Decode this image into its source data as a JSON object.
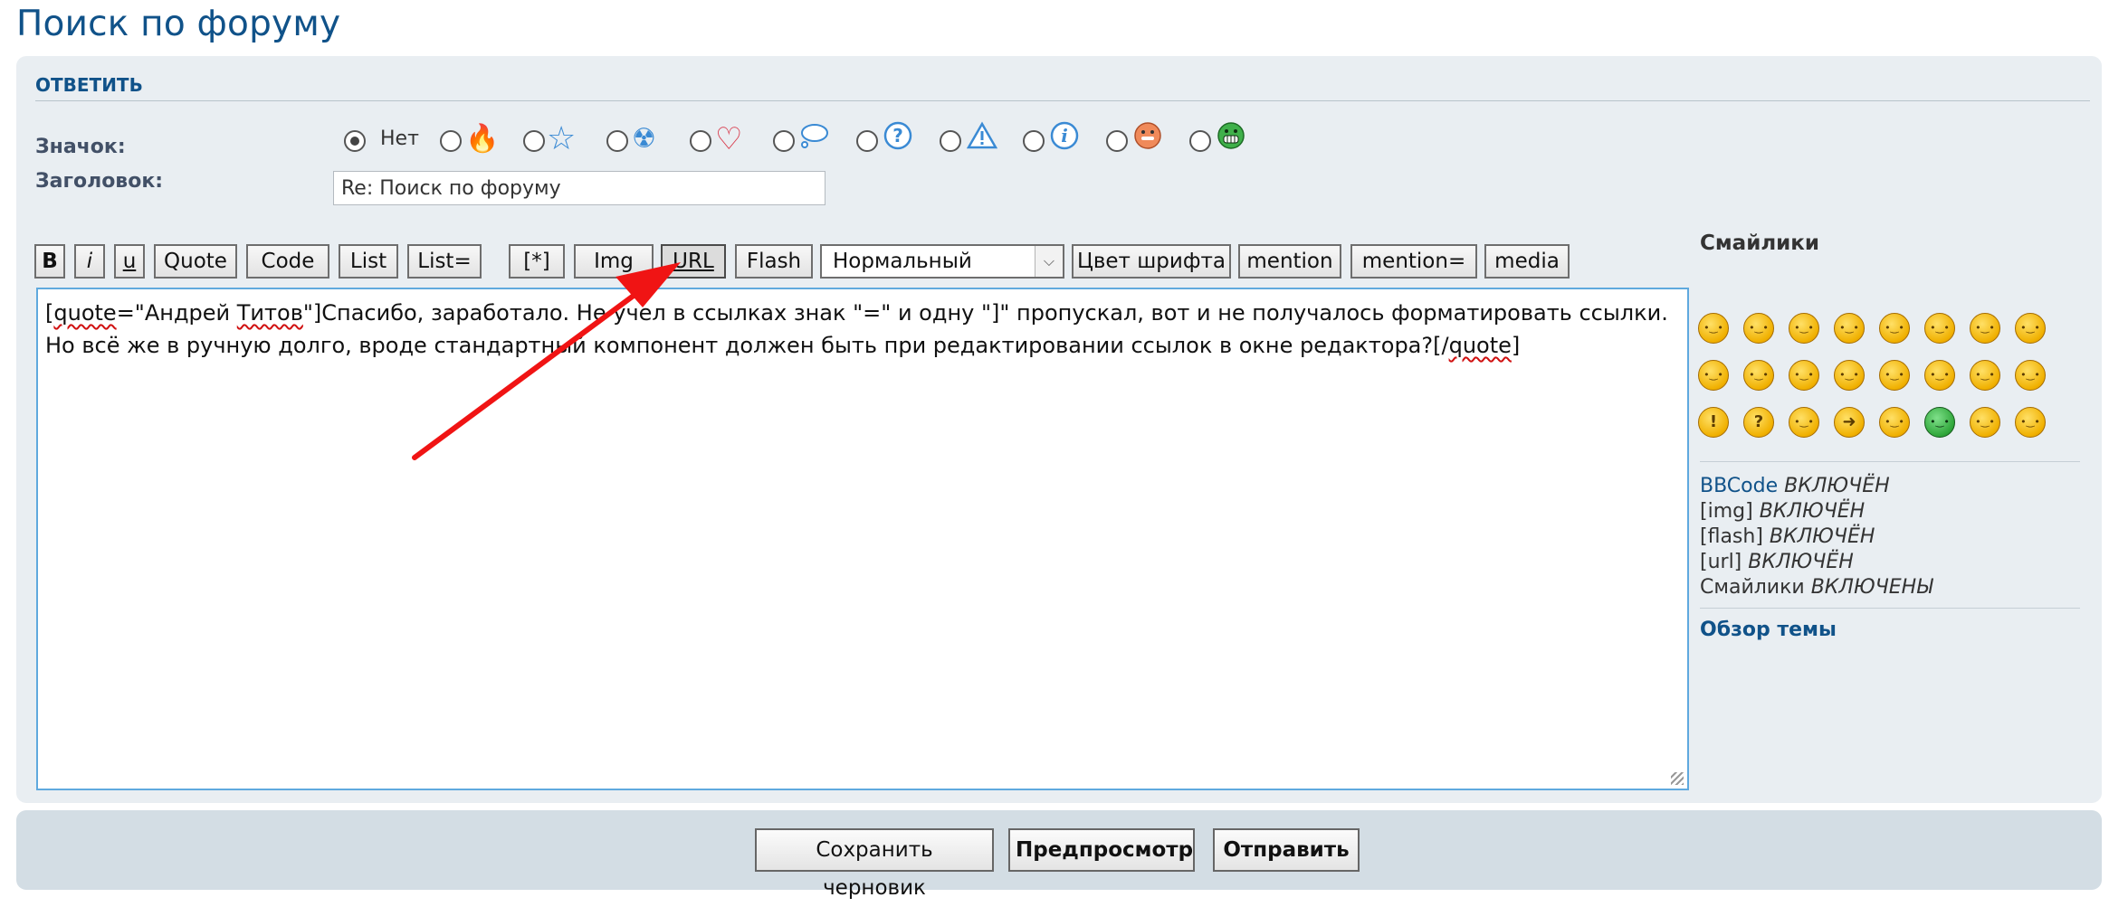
{
  "page": {
    "title": "Поиск по форуму"
  },
  "reply": {
    "section_title": "ОТВЕТИТЬ",
    "icon_label": "Значок:",
    "subject_label": "Заголовок:",
    "subject_value": "Re: Поиск по форуму",
    "icons": [
      {
        "name": "none",
        "text": "Нет",
        "selected": true
      },
      {
        "name": "fire-icon",
        "glyph": "🔥",
        "selected": false
      },
      {
        "name": "star-icon",
        "glyph": "☆",
        "selected": false
      },
      {
        "name": "radioactive-icon",
        "glyph": "☢",
        "selected": false
      },
      {
        "name": "heart-icon",
        "glyph": "♡",
        "selected": false
      },
      {
        "name": "speech-bubble-icon",
        "glyph": "💭",
        "selected": false
      },
      {
        "name": "question-icon",
        "glyph": "?",
        "selected": false
      },
      {
        "name": "warning-icon",
        "glyph": "⚠",
        "selected": false
      },
      {
        "name": "info-icon",
        "glyph": "i",
        "selected": false
      },
      {
        "name": "tongue-face-icon",
        "glyph": "😛",
        "selected": false
      },
      {
        "name": "grin-face-icon",
        "glyph": "😁",
        "selected": false
      }
    ]
  },
  "toolbar": {
    "bold": "B",
    "italic": "i",
    "underline": "u",
    "quote": "Quote",
    "code": "Code",
    "list": "List",
    "list_eq": "List=",
    "list_item": "[*]",
    "img": "Img",
    "url": "URL",
    "flash": "Flash",
    "size_select": "Нормальный",
    "font_color": "Цвет шрифта",
    "mention": "mention",
    "mention_eq": "mention=",
    "media": "media"
  },
  "editor": {
    "line1_a": "[",
    "line1_quote": "quote",
    "line1_b": "=\"Андрей ",
    "line1_titov": "Титов",
    "line1_c": "\"]Спасибо, заработало. Не учел в ссылках знак \"=\" и одну \"]\" пропускал, вот и не получалось форматировать ссылки. Но всё же в ручную долго, вроде стандартный компонент должен быть при редактировании ссылок в окне редактора?[/",
    "line1_quote2": "quote",
    "line1_d": "]"
  },
  "sidebar": {
    "smilies_title": "Смайлики",
    "smilies": [
      "laugh",
      "cheeky",
      "wink",
      "neutral",
      "surprised",
      "confused",
      "sad",
      "cool",
      "tongue",
      "mad",
      "happy",
      "cry",
      "meh",
      "evil",
      "twisted",
      "geek",
      "exclaim",
      "question",
      "idea",
      "arrow",
      "worried",
      "green",
      "nerd",
      "sick"
    ],
    "status": [
      {
        "name": "BBCode",
        "value": "ВКЛЮЧЁН",
        "link": true
      },
      {
        "name": "[img]",
        "value": "ВКЛЮЧЁН",
        "link": false
      },
      {
        "name": "[flash]",
        "value": "ВКЛЮЧЁН",
        "link": false
      },
      {
        "name": "[url]",
        "value": "ВКЛЮЧЁН",
        "link": false
      },
      {
        "name": "Смайлики",
        "value": "ВКЛЮЧЕНЫ",
        "link": false
      }
    ],
    "topic_review": "Обзор темы"
  },
  "actions": {
    "save_draft": "Сохранить черновик",
    "preview": "Предпросмотр",
    "submit": "Отправить"
  },
  "annotation": {
    "arrow_color": "#f01414"
  }
}
